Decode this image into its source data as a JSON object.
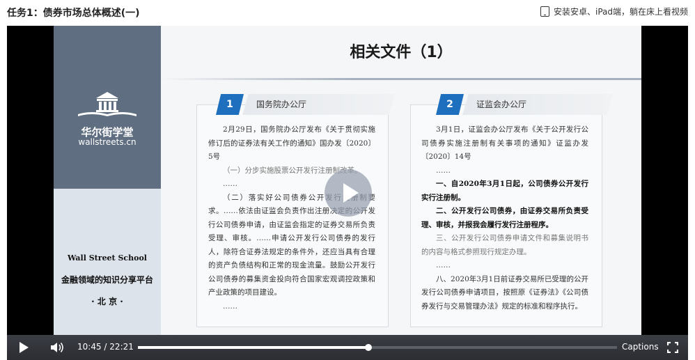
{
  "header": {
    "title": "任务1：债券市场总体概述(一)",
    "app_link_label": "安装安卓、iPad端，躺在床上看视频",
    "app_link_icon": "tablet-icon"
  },
  "slide": {
    "title": "相关文件（1）",
    "brand_cn": "华尔街学堂",
    "brand_en": "wallstreets.cn",
    "school_en": "Wall Street School",
    "school_slogan": "金融领域的知识分享平台",
    "school_city": "· 北 京 ·",
    "panels": [
      {
        "number": "1",
        "label": "国务院办公厅",
        "paragraphs": [
          "2月29日，国务院办公厅发布《关于贯彻实施修订后的证券法有关工作的通知》国办发〔2020〕5号",
          "（一）分步实施股票公开发行注册制改革。",
          "……",
          "（二）落实好公司债券公开发行注册制要求。……依法由证监会负责作出注册决定的公开发行公司债券申请，由证监会指定的证券交易所负责受理、审核。……申请公开发行公司债券的发行人，除符合证券法规定的条件外，还应当具有合理的资产负债结构和正常的现金流量。鼓励公开发行公司债券的募集资金投向符合国家宏观调控政策和产业政策的项目建设。",
          "……"
        ]
      },
      {
        "number": "2",
        "label": "证监会办公厅",
        "paragraphs": [
          "3月1日，证监会办公厅发布《关于公开发行公司债券实施注册制有关事项的通知》证监办发〔2020〕14号",
          "……",
          "一、自2020年3月1日起，公司债券公开发行实行注册制。",
          "二、公开发行公司债券，由证券交易所负责受理、审核，并报我会履行发行注册程序。",
          "三、公开发行公司债券申请文件和募集说明书的内容与格式参照现行规定办理。",
          "……",
          "八、2020年3月1日前证券交易所已受理的公开发行公司债券申请项目，按照原《证券法》《公司债券发行与交易管理办法》规定的标准和程序执行。"
        ]
      }
    ]
  },
  "player": {
    "current_time": "10:45",
    "separator": "/",
    "duration": "22:21",
    "progress": 0.481,
    "captions_label": "Captions"
  },
  "colors": {
    "sidebar_dark": "#5f6e80",
    "sidebar_light": "#dde3eb",
    "tab_blue": "#1f6fbf",
    "control_bar": "#2f3137"
  }
}
